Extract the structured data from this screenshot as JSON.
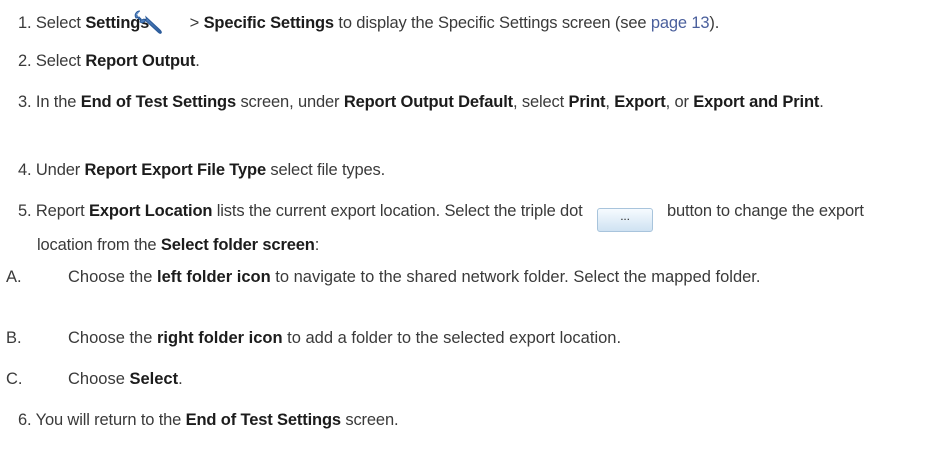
{
  "steps": {
    "s1": {
      "num": "1. ",
      "a": "Select ",
      "b": "Settings",
      "c": " > ",
      "d": "Specific Settings",
      "e": " to display the Specific Settings screen (see ",
      "link": "page 13",
      "f": ")."
    },
    "s2": {
      "num": "2. ",
      "a": "Select ",
      "b": "Report Output",
      "c": "."
    },
    "s3": {
      "num": "3. ",
      "a": "In the ",
      "b": "End of Test Settings",
      "c": " screen, under ",
      "d": "Report Output Default",
      "e": ", select ",
      "f": "Print",
      "g": ", ",
      "h": "Export",
      "i": ", or ",
      "j": "Export and Print",
      "k": "."
    },
    "s4": {
      "num": "4. ",
      "a": "Under ",
      "b": "Report Export File Type",
      "c": " select file types."
    },
    "s5": {
      "num": "5. ",
      "a": "Report ",
      "b": "Export Location",
      "c": " lists the current export location. Select the triple dot ",
      "btn": "...",
      "d": "button to change the export location from the ",
      "e": "Select folder screen",
      "f": ":"
    },
    "s5A": {
      "mk": "A.",
      "a": "Choose the ",
      "b": "left folder icon",
      "c": " to navigate to the shared network folder. Select the mapped folder."
    },
    "s5B": {
      "mk": "B.",
      "a": "Choose the ",
      "b": "right folder icon",
      "c": " to add a folder to the selected export location."
    },
    "s5C": {
      "mk": "C.",
      "a": "Choose ",
      "b": "Select",
      "c": "."
    },
    "s6": {
      "num": "6. ",
      "a": "You will return to the ",
      "b": "End of Test Settings",
      "c": " screen."
    }
  },
  "icons": {
    "settings": "wrench-icon"
  },
  "colors": {
    "text": "#3a3a3a",
    "bold": "#1c1c1c",
    "link": "#4a5f9c",
    "wrench": "#3b6fb0"
  }
}
